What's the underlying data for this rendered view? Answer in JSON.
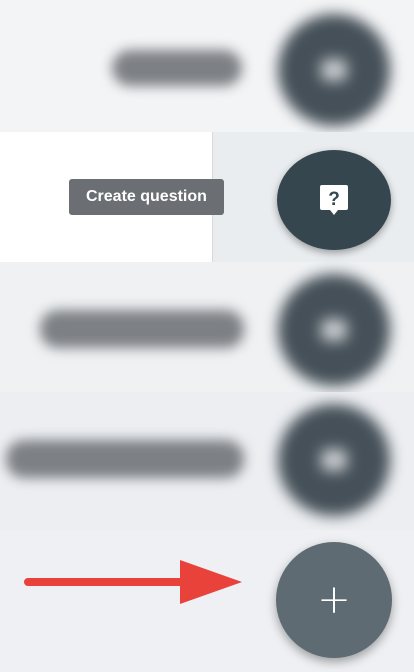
{
  "speed_dial": {
    "create_question_tooltip": "Create question",
    "main_button_symbol": "+"
  },
  "colors": {
    "question_fab": "#36464f",
    "main_fab": "#5f6b72",
    "tooltip_bg": "#6b6f73",
    "annotation_arrow": "#e8423a"
  },
  "icons": {
    "question": "question-bubble-icon",
    "main": "plus-icon",
    "annotation": "red-arrow-right"
  }
}
